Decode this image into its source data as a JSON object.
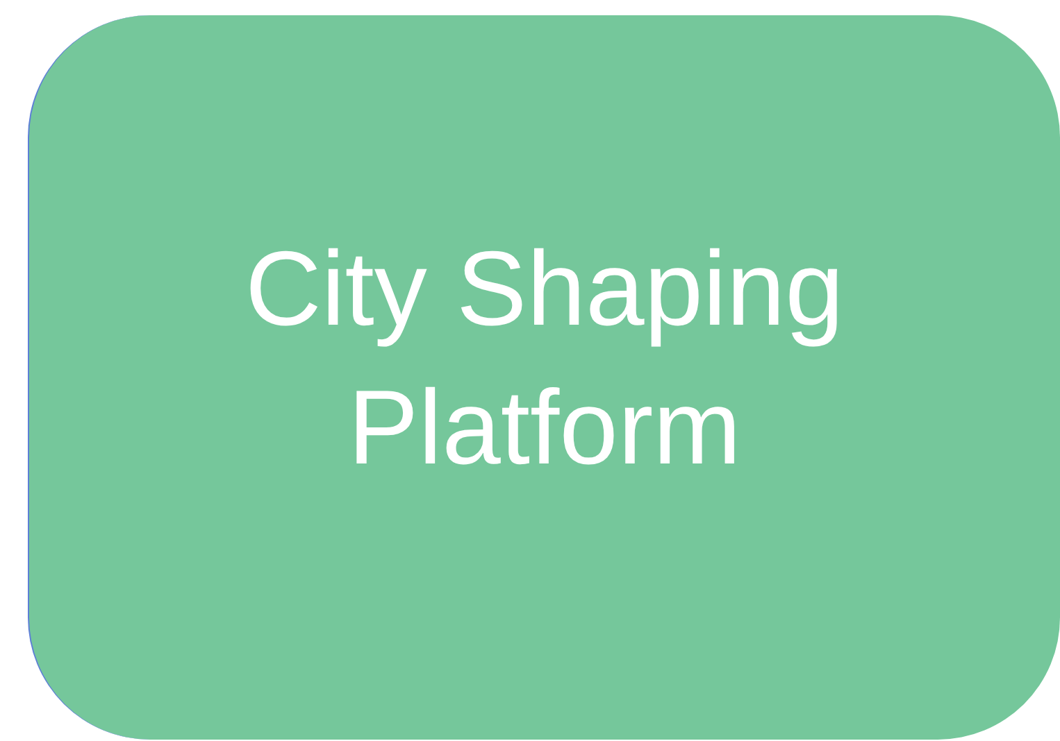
{
  "shape": {
    "label": "City Shaping Platform",
    "color": "#75c79b"
  }
}
